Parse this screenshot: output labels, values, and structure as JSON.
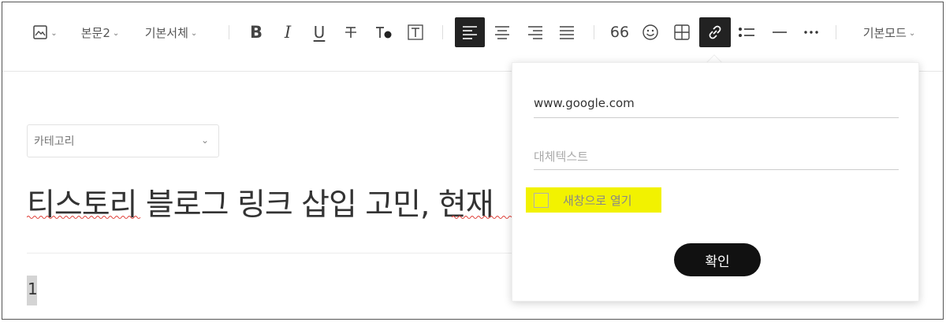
{
  "toolbar": {
    "image_icon": "image-icon",
    "paragraph_style": "본문2",
    "font_family": "기본서체",
    "bold": "B",
    "italic": "I",
    "underline": "U",
    "strikethrough": "T",
    "quote": "66",
    "mode": "기본모드"
  },
  "editor": {
    "category_placeholder": "카테고리",
    "title": "티스토리 블로그 링크 삽입 고민, 현재",
    "body_text": "1"
  },
  "link_popup": {
    "url_value": "www.google.com",
    "alt_placeholder": "대체텍스트",
    "open_new_window_label": "새창으로 열기",
    "open_new_window_checked": false,
    "confirm_label": "확인"
  },
  "colors": {
    "active_button": "#222222",
    "highlight": "#f2f200",
    "confirm_button": "#111111"
  }
}
